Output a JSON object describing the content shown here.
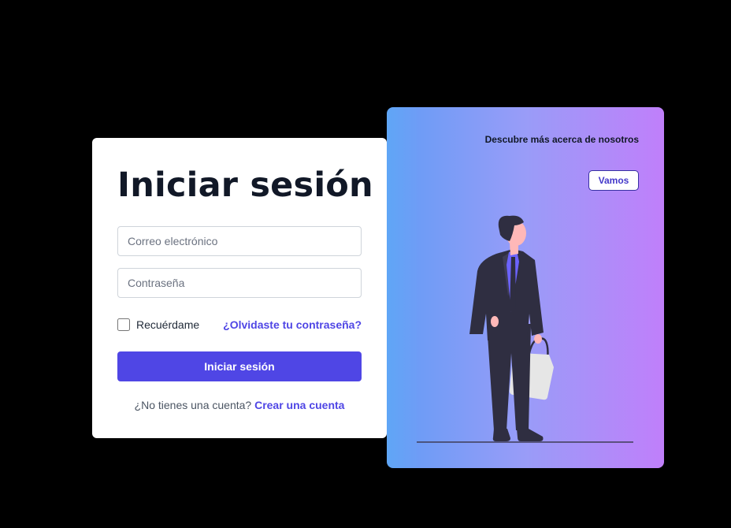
{
  "login": {
    "title": "Iniciar sesión",
    "email_placeholder": "Correo electrónico",
    "password_placeholder": "Contraseña",
    "remember_label": "Recuérdame",
    "forgot_link": "¿Olvidaste tu contraseña?",
    "submit_label": "Iniciar sesión",
    "no_account_text": "¿No tienes una cuenta?",
    "signup_link": "Crear una cuenta"
  },
  "promo": {
    "heading": "Descubre más acerca de nosotros",
    "button_label": "Vamos",
    "illustration_icon": "standing-person-with-shopping-bag-illustration"
  },
  "colors": {
    "background": "#000000",
    "accent": "#4f46e5",
    "title_text": "#111827",
    "promo_gradient_start": "#5fa6f6",
    "promo_gradient_end": "#c07ffa"
  }
}
